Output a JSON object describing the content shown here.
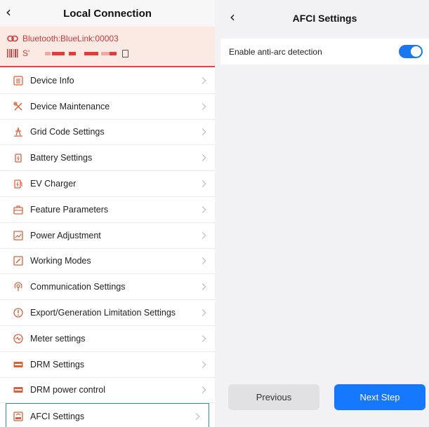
{
  "left_panel": {
    "back_icon": "chevron-left-icon",
    "title": "Local Connection",
    "device": {
      "bluetooth_label": "Bluetooth:BlueLink:00003",
      "serial_prefix": "S'",
      "accent_color": "#d94848"
    },
    "menu": [
      {
        "label": "Device Info",
        "icon": "device-info-icon"
      },
      {
        "label": "Device Maintenance",
        "icon": "maintenance-tools-icon"
      },
      {
        "label": "Grid Code Settings",
        "icon": "grid-code-icon"
      },
      {
        "label": "Battery Settings",
        "icon": "battery-icon"
      },
      {
        "label": "EV Charger",
        "icon": "ev-charger-icon"
      },
      {
        "label": "Feature Parameters",
        "icon": "feature-parameters-icon"
      },
      {
        "label": "Power Adjustment",
        "icon": "power-adjustment-icon"
      },
      {
        "label": "Working Modes",
        "icon": "working-modes-icon"
      },
      {
        "label": "Communication Settings",
        "icon": "communication-icon"
      },
      {
        "label": "Export/Generation Limitation Settings",
        "icon": "export-limit-icon"
      },
      {
        "label": "Meter settings",
        "icon": "meter-icon"
      },
      {
        "label": "DRM Settings",
        "icon": "drm-icon"
      },
      {
        "label": "DRM power control",
        "icon": "drm-power-icon"
      },
      {
        "label": "AFCI Settings",
        "icon": "afci-icon",
        "selected": true
      }
    ]
  },
  "right_panel": {
    "back_icon": "chevron-left-icon",
    "title": "AFCI Settings",
    "setting": {
      "label": "Enable anti-arc detection",
      "enabled": true,
      "toggle_color": "#1977f3"
    },
    "buttons": {
      "previous": "Previous",
      "next": "Next Step",
      "next_color": "#1677ff"
    }
  }
}
